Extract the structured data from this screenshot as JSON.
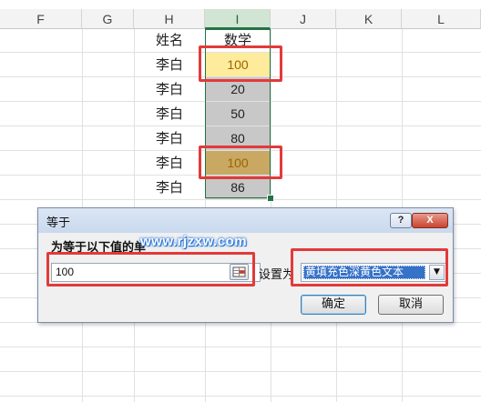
{
  "sheet": {
    "column_headers": [
      "F",
      "G",
      "H",
      "I",
      "J",
      "K",
      "L"
    ],
    "name_header": "姓名",
    "score_header": "数学",
    "rows": [
      {
        "name": "李白",
        "score": "100"
      },
      {
        "name": "李白",
        "score": "20"
      },
      {
        "name": "李白",
        "score": "50"
      },
      {
        "name": "李白",
        "score": "80"
      },
      {
        "name": "李白",
        "score": "100"
      },
      {
        "name": "李白",
        "score": "86"
      }
    ]
  },
  "dialog": {
    "title": "等于",
    "label": "为等于以下值的单",
    "watermark": "www.rjzxw.com",
    "value": "100",
    "set_as_label": "设置为",
    "format_selected": "黄填充色深黄色文本",
    "ok_label": "确定",
    "cancel_label": "取消",
    "help_label": "?",
    "close_label": "X"
  },
  "colors": {
    "highlight_fill": "#ffeb9c",
    "highlight_text": "#9c6500",
    "annotation_red": "#e23a3a",
    "selection_green": "#217346"
  }
}
